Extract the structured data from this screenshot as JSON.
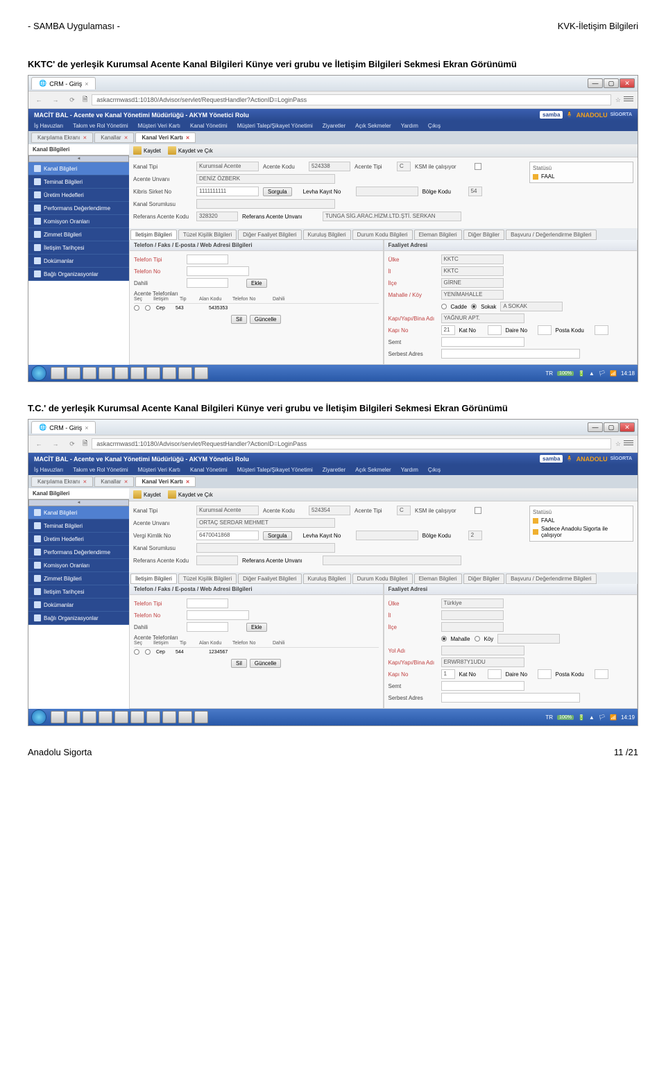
{
  "doc": {
    "header_left": "- SAMBA Uygulaması -",
    "header_right": "KVK-İletişim Bilgileri",
    "title1": "KKTC' de yerleşik Kurumsal Acente Kanal Bilgileri Künye veri grubu ve İletişim Bilgileri Sekmesi Ekran Görünümü",
    "title2": "T.C.' de yerleşik Kurumsal Acente Kanal Bilgileri Künye veri grubu ve İletişim Bilgileri Sekmesi Ekran Görünümü",
    "footer_left": "Anadolu Sigorta",
    "footer_right": "11 /21"
  },
  "browser": {
    "tab_title": "CRM - Giriş",
    "url": "askacrmwasd1:10180/Advisor/servlet/RequestHandler?ActionID=LoginPass"
  },
  "app": {
    "header_title": "MACİT BAL - Acente ve Kanal Yönetimi Müdürlüğü - AKYM Yönetici Rolu",
    "brand1": "samba",
    "brand2": "ANADOLU",
    "brand3": "SİGORTA",
    "menu": [
      "İş Havuzları",
      "Takım ve Rol Yönetimi",
      "Müşteri Veri Kartı",
      "Kanal Yönetimi",
      "Müşteri Talep/Şikayet Yönetimi",
      "Ziyaretler",
      "Açık Sekmeler",
      "Yardım",
      "Çıkış"
    ],
    "tabs": {
      "t1": "Karşılama Ekranı",
      "t2": "Kanallar",
      "t3": "Kanal Veri Kartı"
    },
    "page_label": "Kanal Bilgileri",
    "toolbar": {
      "save": "Kaydet",
      "save_exit": "Kaydet ve Çık"
    },
    "sidebar": [
      "Kanal Bilgileri",
      "Teminat Bilgileri",
      "Üretim Hedefleri",
      "Performans Değerlendirme",
      "Komisyon Oranları",
      "Zimmet Bilgileri",
      "İletişim Tarihçesi",
      "Dokümanlar",
      "Bağlı Organizasyonlar"
    ]
  },
  "labels": {
    "kanal_tipi": "Kanal Tipi",
    "acente_kodu": "Acente Kodu",
    "acente_tipi": "Acente Tipi",
    "ksm": "KSM ile çalışıyor",
    "acente_unvani": "Acente Unvanı",
    "kibris_sirket_no": "Kibris Sirket No",
    "vergi_kimlik_no": "Vergi Kimlik No",
    "sorgula": "Sorgula",
    "levha_kayit_no": "Levha Kayıt No",
    "bolge_kodu": "Bölge Kodu",
    "kanal_sorumlusu": "Kanal Sorumlusu",
    "ref_acente_kodu": "Referans Acente Kodu",
    "ref_acente_unvani": "Referans Acente Unvanı",
    "statusu": "Statüsü",
    "faal": "FAAL",
    "sadece_anadolu": "Sadece Anadolu Sigorta ile çalışıyor"
  },
  "subtabs": [
    "İletişim Bilgileri",
    "Tüzel Kişilik Bilgileri",
    "Diğer Faaliyet Bilgileri",
    "Kuruluş Bilgileri",
    "Durum Kodu Bilgileri",
    "Eleman Bilgileri",
    "Diğer Bilgiler",
    "Başvuru / Değerlendirme Bilgileri"
  ],
  "contact": {
    "header_left": "Telefon / Faks / E-posta / Web Adresi Bilgileri",
    "header_right": "Faaliyet Adresi",
    "telefon_tipi": "Telefon Tipi",
    "telefon_no": "Telefon No",
    "dahili": "Dahili",
    "ekle": "Ekle",
    "acente_telefonlari": "Acente Telefonları",
    "th": [
      "Seç",
      "İletişim",
      "Tip",
      "Alan Kodu",
      "Telefon No",
      "Dahili"
    ],
    "cep": "Cep",
    "sil": "Sil",
    "guncelle": "Güncelle",
    "ulke": "Ülke",
    "il": "İl",
    "ilce": "İlçe",
    "mahalle_koy": "Mahalle / Köy",
    "mahalle": "Mahalle",
    "koy": "Köy",
    "cadde": "Cadde",
    "sokak": "Sokak",
    "yol_adi": "Yol Adı",
    "kapi_bina": "Kapı/Yapı/Bina Adı",
    "kapi_no": "Kapı No",
    "kat_no": "Kat No",
    "daire_no": "Daire No",
    "posta_kodu": "Posta Kodu",
    "semt": "Semt",
    "serbest_adres": "Serbest Adres"
  },
  "s1": {
    "kanal_tipi_val": "Kurumsal Acente",
    "acente_kodu_val": "524338",
    "acente_tipi_val": "C",
    "acente_unvani_val": "DENİZ ÖZBERK",
    "kibris_val": "1111111111",
    "bolge_kodu_val": "54",
    "ref_kodu_val": "328320",
    "ref_unvan_val": "TUNGA SİG.ARAC.HİZM.LTD.ŞTİ. SERKAN",
    "tel_alan": "543",
    "tel_no": "5435353",
    "ulke_val": "KKTC",
    "il_val": "KKTC",
    "ilce_val": "GİRNE",
    "mahalle_val": "YENİMAHALLE",
    "sokak_val": "A SOKAK",
    "bina_val": "YAĞNUR APT.",
    "kapi_no_val": "21",
    "time": "14:18"
  },
  "s2": {
    "kanal_tipi_val": "Kurumsal Acente",
    "acente_kodu_val": "524354",
    "acente_tipi_val": "C",
    "acente_unvani_val": "ORTAÇ SERDAR MEHMET",
    "vergi_val": "6470041868",
    "bolge_kodu_val": "2",
    "tel_alan": "544",
    "tel_no": "1234567",
    "ulke_val": "Türkiye",
    "bina_val": "ERWR87Y1UDU",
    "kapi_no_val": "1",
    "time": "14:19"
  },
  "tray": {
    "lang": "TR",
    "pct": "100%"
  }
}
